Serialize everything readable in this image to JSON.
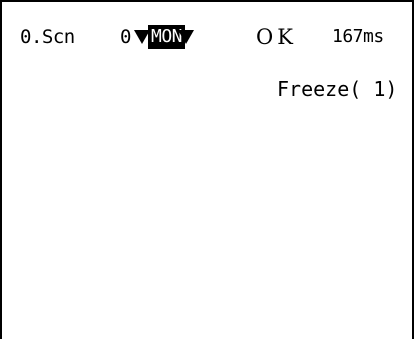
{
  "status_bar": {
    "scene_label": "0.Scn",
    "scene_number": "0",
    "mode": "MON",
    "result": "OK",
    "time": "167ms"
  },
  "display": {
    "freeze_label": "Freeze( 1)"
  },
  "icons": {
    "scene_dropdown": "triangle-down-icon",
    "mode_dropdown": "triangle-down-icon"
  },
  "colors": {
    "background": "#ffffff",
    "foreground": "#000000",
    "badge_bg": "#000000",
    "badge_fg": "#ffffff"
  }
}
